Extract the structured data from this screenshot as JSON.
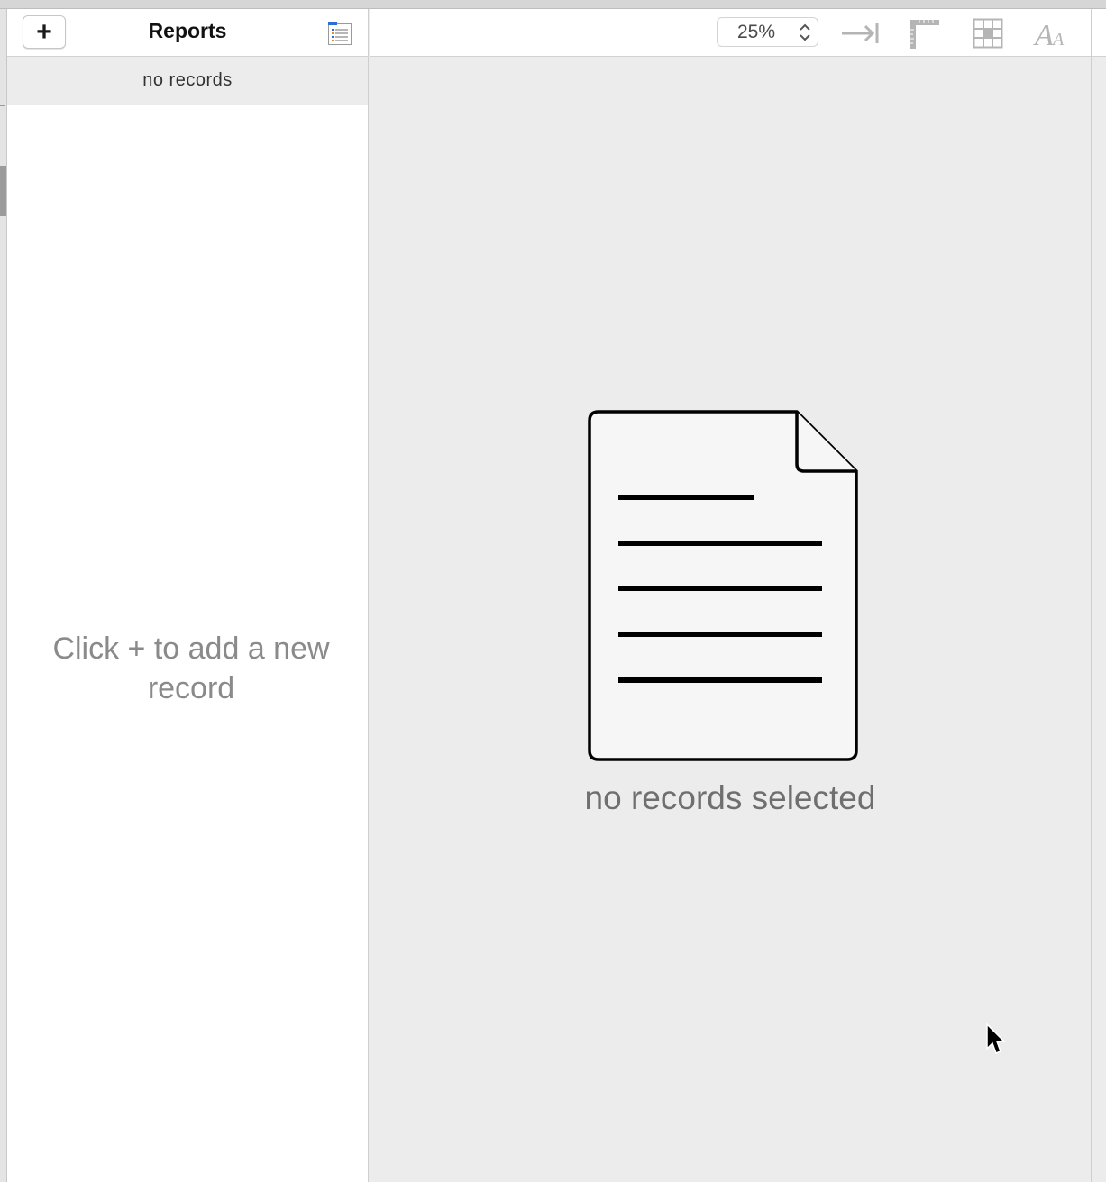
{
  "sidebar": {
    "add_label": "+",
    "title": "Reports",
    "records_count_label": "no records",
    "empty_hint": "Click + to add a new record"
  },
  "toolbar": {
    "zoom_value": "25%"
  },
  "main": {
    "empty_message": "no records selected"
  },
  "icons": {
    "list": "list-icon",
    "zoom_stepper": "chevron-up-down-icon",
    "indent": "arrow-to-bar-icon",
    "ruler": "ruler-icon",
    "grid": "grid-icon",
    "font": "font-icon",
    "document": "document-icon",
    "pointer": "cursor-icon"
  },
  "colors": {
    "accent_blue": "#2b6fd6",
    "icon_gray": "#b5b5b5",
    "hint_gray": "#8a8a8a"
  }
}
